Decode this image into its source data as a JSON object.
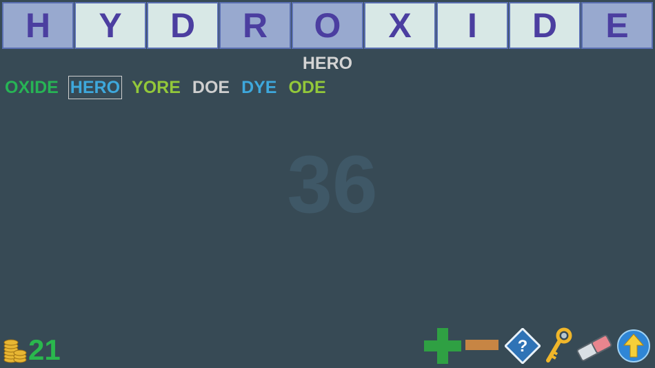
{
  "tiles": [
    {
      "letter": "H",
      "shade": "dark"
    },
    {
      "letter": "Y",
      "shade": "light"
    },
    {
      "letter": "D",
      "shade": "light"
    },
    {
      "letter": "R",
      "shade": "dark"
    },
    {
      "letter": "O",
      "shade": "dark"
    },
    {
      "letter": "X",
      "shade": "light"
    },
    {
      "letter": "I",
      "shade": "light"
    },
    {
      "letter": "D",
      "shade": "light"
    },
    {
      "letter": "E",
      "shade": "dark"
    }
  ],
  "current_word": "HERO",
  "found_words": [
    {
      "text": "OXIDE",
      "color": "#27b455",
      "selected": false
    },
    {
      "text": "HERO",
      "color": "#3ea8dc",
      "selected": true
    },
    {
      "text": "YORE",
      "color": "#93c83a",
      "selected": false
    },
    {
      "text": "DOE",
      "color": "#cfcfcf",
      "selected": false
    },
    {
      "text": "DYE",
      "color": "#3ea8dc",
      "selected": false
    },
    {
      "text": "ODE",
      "color": "#93c83a",
      "selected": false
    }
  ],
  "remaining_count": "36",
  "coins": "21",
  "toolbar": {
    "add_icon": "plus-icon",
    "remove_icon": "minus-icon",
    "hint_icon": "question-diamond-icon",
    "key_icon": "key-icon",
    "eraser_icon": "eraser-icon",
    "submit_icon": "up-arrow-icon"
  },
  "colors": {
    "background": "#374a55",
    "tile_dark": "#98a9cf",
    "tile_light": "#d8e8e6",
    "tile_letter": "#4b3ea0",
    "coin_score": "#2ab84d"
  }
}
